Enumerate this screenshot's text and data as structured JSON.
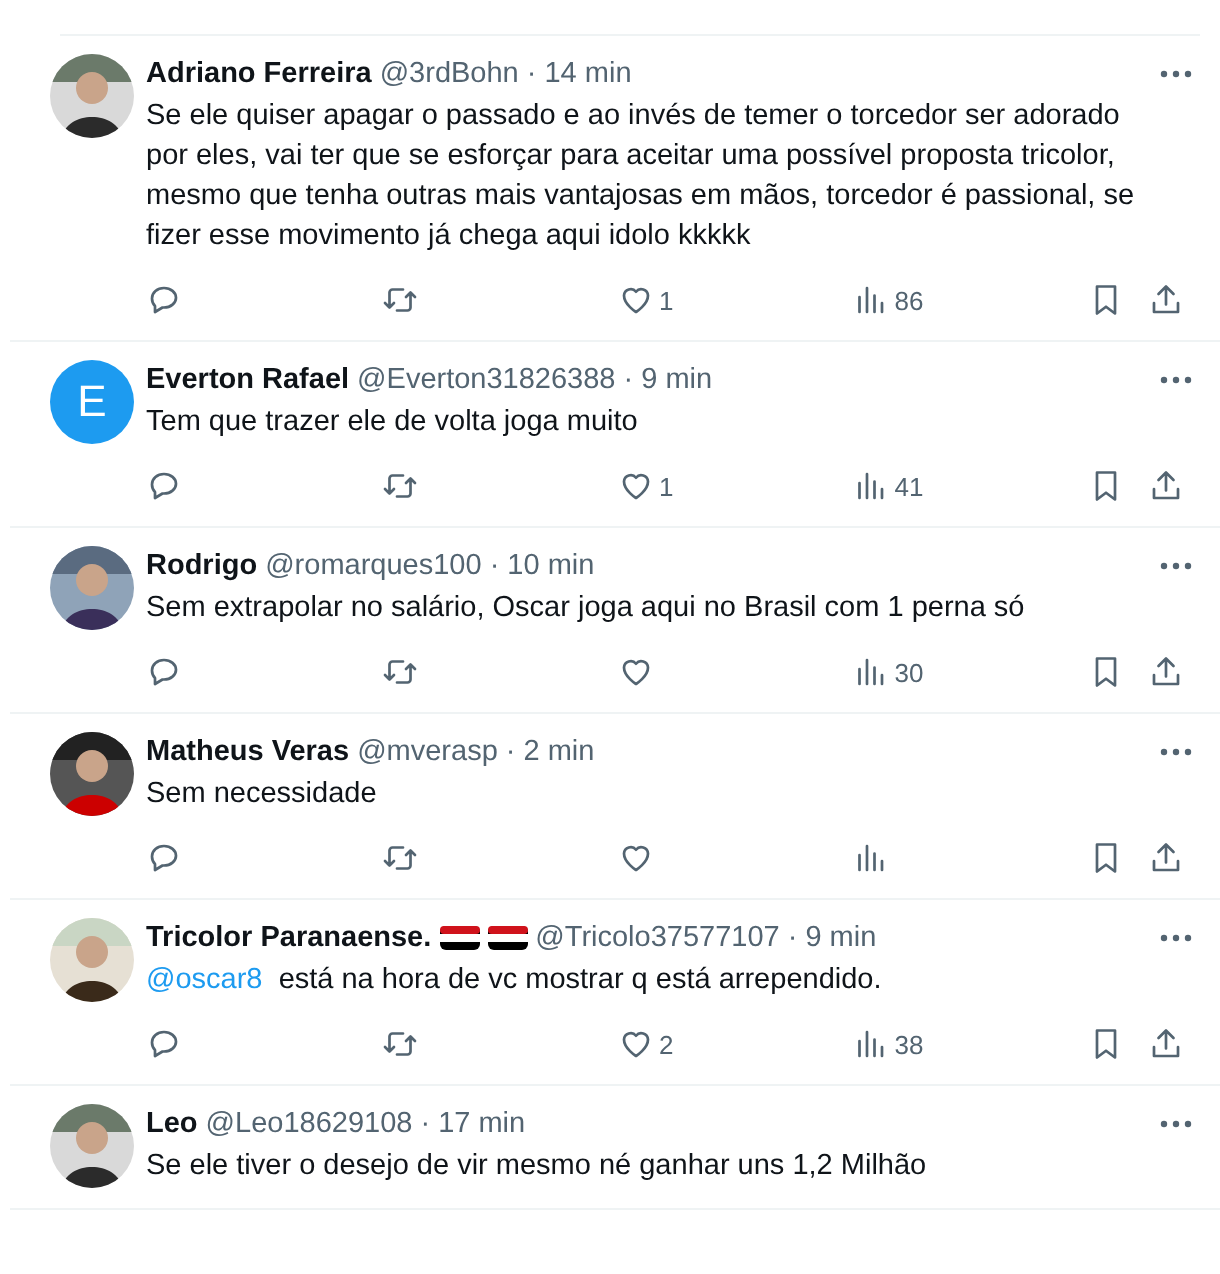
{
  "replies": [
    {
      "name": "Adriano Ferreira",
      "handle": "@3rdBohn",
      "time": "· 14 min",
      "text": "Se ele quiser apagar o passado e ao invés de temer o torcedor ser adorado por eles, vai ter que se esforçar para aceitar uma possível proposta tricolor, mesmo que tenha outras mais vantajosas em mãos, torcedor é passional, se fizer esse movimento já chega aqui idolo kkkkk",
      "actions": [
        {
          "kind": "reply"
        },
        {
          "kind": "repost"
        },
        {
          "kind": "like",
          "count": "1"
        },
        {
          "kind": "views",
          "count": "86"
        },
        {
          "kind": "bookmark"
        },
        {
          "kind": "share"
        }
      ]
    },
    {
      "avatar": {
        "kind": "letter",
        "letter": "E"
      },
      "name": "Everton Rafael",
      "handle": "@Everton31826388",
      "time": "· 9 min",
      "text": "Tem que trazer ele de volta joga muito",
      "actions": [
        {
          "kind": "reply"
        },
        {
          "kind": "repost"
        },
        {
          "kind": "like",
          "count": "1"
        },
        {
          "kind": "views",
          "count": "41"
        },
        {
          "kind": "bookmark"
        },
        {
          "kind": "share"
        }
      ]
    },
    {
      "name": "Rodrigo",
      "handle": "@romarques100",
      "time": "· 10 min",
      "text": "Sem extrapolar no salário, Oscar joga aqui no Brasil com 1 perna só",
      "actions": [
        {
          "kind": "reply"
        },
        {
          "kind": "repost"
        },
        {
          "kind": "like"
        },
        {
          "kind": "views",
          "count": "30"
        },
        {
          "kind": "bookmark"
        },
        {
          "kind": "share"
        }
      ]
    },
    {
      "name": "Matheus Veras",
      "handle": "@mverasp",
      "time": "· 2 min",
      "text": "Sem necessidade",
      "actions": [
        {
          "kind": "reply"
        },
        {
          "kind": "repost"
        },
        {
          "kind": "like"
        },
        {
          "kind": "views"
        },
        {
          "kind": "bookmark"
        },
        {
          "kind": "share"
        }
      ]
    },
    {
      "name": "Tricolor Paranaense.",
      "name_badges": [
        {
          "kind": "flag"
        },
        {
          "kind": "flag"
        }
      ],
      "handle": "@Tricolo37577107",
      "time": "· 9 min",
      "mention": "@oscar8",
      "text": "está na hora de vc mostrar q está arrependido.",
      "actions": [
        {
          "kind": "reply"
        },
        {
          "kind": "repost"
        },
        {
          "kind": "like",
          "count": "2"
        },
        {
          "kind": "views",
          "count": "38"
        },
        {
          "kind": "bookmark"
        },
        {
          "kind": "share"
        }
      ]
    },
    {
      "name": "Leo",
      "handle": "@Leo18629108",
      "time": "· 17 min",
      "text": "Se ele tiver o desejo de vir mesmo né ganhar uns 1,2 Milhão"
    }
  ]
}
